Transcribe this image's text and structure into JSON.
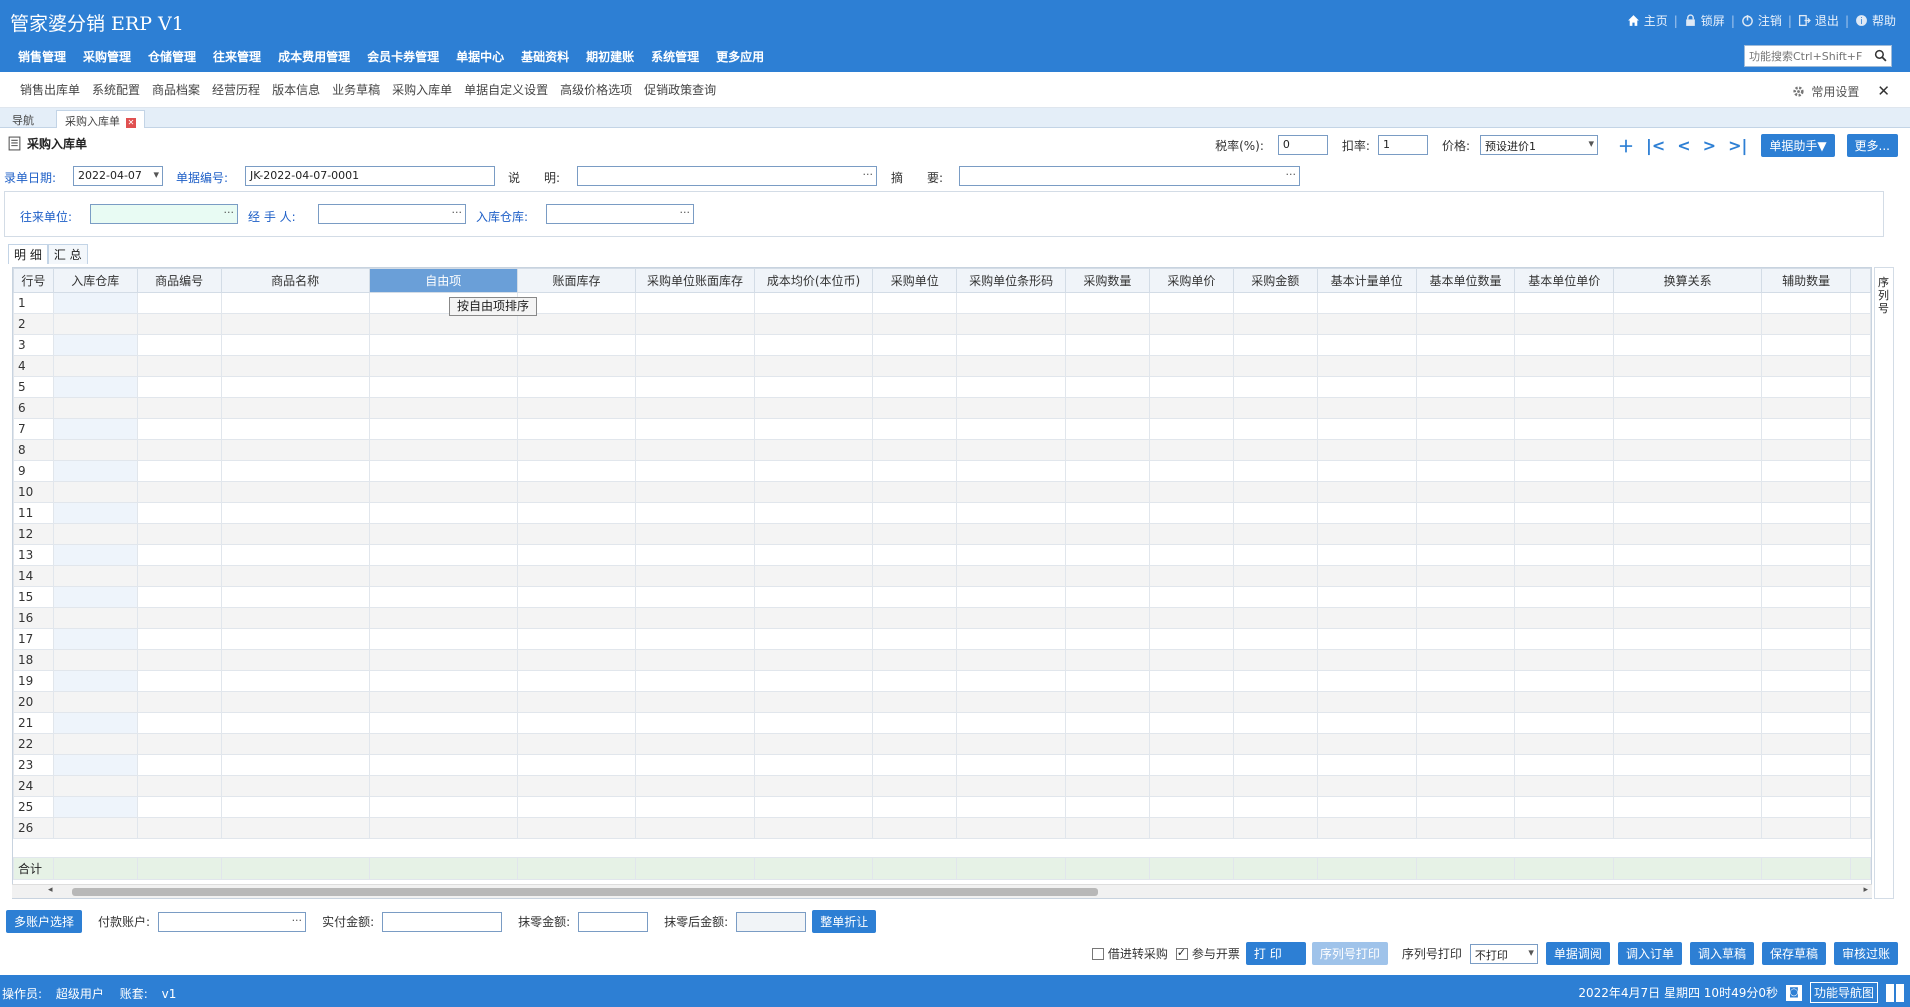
{
  "app": {
    "title": "管家婆分销 ERP V1"
  },
  "top_links": [
    {
      "label": "主页",
      "icon": "home-icon"
    },
    {
      "label": "锁屏",
      "icon": "lock-icon"
    },
    {
      "label": "注销",
      "icon": "power-icon"
    },
    {
      "label": "退出",
      "icon": "exit-icon"
    },
    {
      "label": "帮助",
      "icon": "help-icon"
    }
  ],
  "menu": [
    "销售管理",
    "采购管理",
    "仓储管理",
    "往来管理",
    "成本费用管理",
    "会员卡券管理",
    "单据中心",
    "基础资料",
    "期初建账",
    "系统管理",
    "更多应用"
  ],
  "search": {
    "placeholder": "功能搜索Ctrl+Shift+F"
  },
  "quick_links": [
    "销售出库单",
    "系统配置",
    "商品档案",
    "经营历程",
    "版本信息",
    "业务草稿",
    "采购入库单",
    "单据自定义设置",
    "高级价格选项",
    "促销政策查询"
  ],
  "quick_right": {
    "label": "常用设置"
  },
  "tabs": {
    "nav": "导航",
    "active": "采购入库单"
  },
  "form": {
    "title": "采购入库单",
    "tax_label": "税率(%):",
    "tax_value": "0",
    "discount_label": "扣率:",
    "discount_value": "1",
    "price_label": "价格:",
    "price_value": "预设进价1",
    "helper_btn": "单据助手▼",
    "more_btn": "更多...",
    "date_label": "录单日期:",
    "date_value": "2022-04-07",
    "no_label": "单据编号:",
    "no_value": "JK-2022-04-07-0001",
    "desc_label": "说　　明:",
    "desc_value": "",
    "summary_label": "摘　　要:",
    "summary_value": "",
    "partner_label": "往来单位:",
    "handler_label": "经 手 人:",
    "warehouse_label": "入库仓库:"
  },
  "subtabs": [
    "明 细",
    "汇 总"
  ],
  "grid": {
    "columns": [
      "行号",
      "入库仓库",
      "商品编号",
      "商品名称",
      "自由项",
      "账面库存",
      "采购单位账面库存",
      "成本均价(本位币)",
      "采购单位",
      "采购单位条形码",
      "采购数量",
      "采购单价",
      "采购金额",
      "基本计量单位",
      "基本单位数量",
      "基本单位单价",
      "换算关系",
      "辅助数量"
    ],
    "rows": [
      "1",
      "2",
      "3",
      "4",
      "5",
      "6",
      "7",
      "8",
      "9",
      "10",
      "11",
      "12",
      "13",
      "14",
      "15",
      "16",
      "17",
      "18",
      "19",
      "20",
      "21",
      "22",
      "23",
      "24",
      "25",
      "26"
    ],
    "total_label": "合计",
    "sort_popup": "按自由项排序",
    "side_label": "序列号"
  },
  "bottom": {
    "multi_account_btn": "多账户选择",
    "pay_account_label": "付款账户:",
    "paid_label": "实付金额:",
    "round_label": "抹零金额:",
    "after_round_label": "抹零后金额:",
    "whole_discount_btn": "整单折让",
    "borrow_label": "借进转采购",
    "invoice_label": "参与开票",
    "print_btn": "打 印",
    "serial_print_btn": "序列号打印",
    "serial_print_label": "序列号打印",
    "serial_print_value": "不打印",
    "actions": [
      "单据调阅",
      "调入订单",
      "调入草稿",
      "保存草稿",
      "审核过账"
    ]
  },
  "status": {
    "operator_label": "操作员:",
    "operator": "超级用户",
    "account_label": "账套:",
    "account": "v1",
    "datetime": "2022年4月7日 星期四 10时49分0秒",
    "nav_btn": "功能导航图"
  },
  "colors": {
    "primary": "#2d7fd4",
    "selected_header": "#6a9fd8",
    "total_row": "#e6f2e6"
  }
}
